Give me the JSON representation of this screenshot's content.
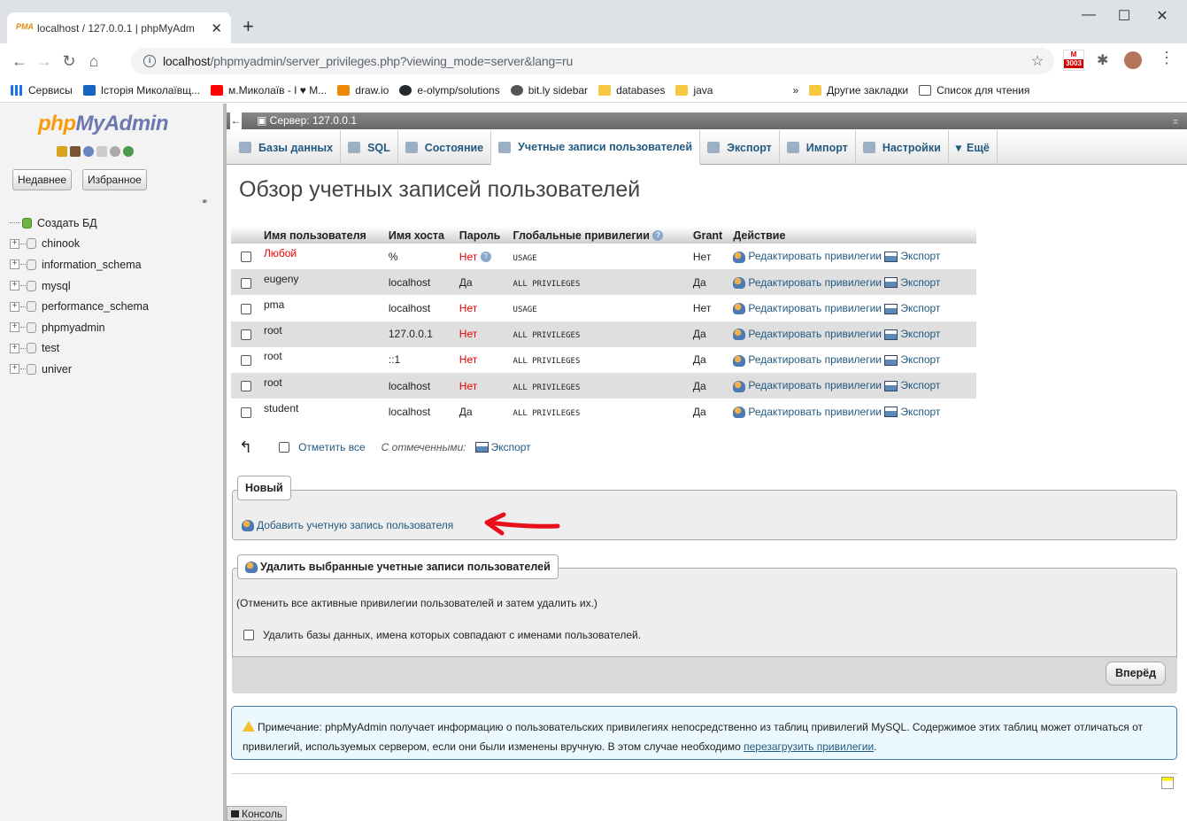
{
  "browser": {
    "tab_title": "localhost / 127.0.0.1 | phpMyAdm",
    "tab_favicon": "PMA",
    "url_host": "localhost",
    "url_path": "/phpmyadmin/server_privileges.php?viewing_mode=server&lang=ru",
    "ext_badge": "3003",
    "ext_label": "M",
    "bookmarks": [
      {
        "label": "Сервисы",
        "icon": "apps-icon"
      },
      {
        "label": "Історія Миколаївщ...",
        "icon": "bookmark-icon"
      },
      {
        "label": "м.Миколаїв - I ♥ M...",
        "icon": "youtube-icon"
      },
      {
        "label": "draw.io",
        "icon": "drawio-icon"
      },
      {
        "label": "e-olymp/solutions",
        "icon": "github-icon"
      },
      {
        "label": "bit.ly sidebar",
        "icon": "bitly-icon"
      },
      {
        "label": "databases",
        "icon": "folder-icon"
      },
      {
        "label": "java",
        "icon": "folder-icon"
      }
    ],
    "bm_more": "»",
    "bm_other": "Другие закладки",
    "bm_reading": "Список для чтения"
  },
  "nav": {
    "logo_php": "php",
    "logo_myadmin": "MyAdmin",
    "recent": "Недавнее",
    "favorites": "Избранное",
    "create_db": "Создать БД",
    "databases": [
      "chinook",
      "information_schema",
      "mysql",
      "performance_schema",
      "phpmyadmin",
      "test",
      "univer"
    ]
  },
  "main": {
    "server_label": "Сервер: 127.0.0.1",
    "tabs": [
      "Базы данных",
      "SQL",
      "Состояние",
      "Учетные записи пользователей",
      "Экспорт",
      "Импорт",
      "Настройки",
      "Ещё"
    ],
    "title": "Обзор учетных записей пользователей",
    "table": {
      "headers": [
        "Имя пользователя",
        "Имя хоста",
        "Пароль",
        "Глобальные привилегии",
        "Grant",
        "Действие"
      ],
      "rows": [
        {
          "user": "Любой",
          "host": "%",
          "password": "Нет",
          "privileges": "USAGE",
          "grant": "Нет"
        },
        {
          "user": "eugeny",
          "host": "localhost",
          "password": "Да",
          "privileges": "ALL PRIVILEGES",
          "grant": "Да"
        },
        {
          "user": "pma",
          "host": "localhost",
          "password": "Нет",
          "privileges": "USAGE",
          "grant": "Нет"
        },
        {
          "user": "root",
          "host": "127.0.0.1",
          "password": "Нет",
          "privileges": "ALL PRIVILEGES",
          "grant": "Да"
        },
        {
          "user": "root",
          "host": "::1",
          "password": "Нет",
          "privileges": "ALL PRIVILEGES",
          "grant": "Да"
        },
        {
          "user": "root",
          "host": "localhost",
          "password": "Нет",
          "privileges": "ALL PRIVILEGES",
          "grant": "Да"
        },
        {
          "user": "student",
          "host": "localhost",
          "password": "Да",
          "privileges": "ALL PRIVILEGES",
          "grant": "Да"
        }
      ],
      "edit_label": "Редактировать привилегии",
      "export_label": "Экспорт"
    },
    "check_all": "Отметить все",
    "with_selected": "С отмеченными:",
    "export": "Экспорт",
    "new_legend": "Новый",
    "add_user": "Добавить учетную запись пользователя",
    "delete_legend": "Удалить выбранные учетные записи пользователей",
    "delete_note": "(Отменить все активные привилегии пользователей и затем удалить их.)",
    "drop_db": "Удалить базы данных, имена которых совпадают с именами пользователей.",
    "go": "Вперёд",
    "notice_text": "Примечание: phpMyAdmin получает информацию о пользовательских привилегиях непосредственно из таблиц привилегий MySQL. Содержимое этих таблиц может отличаться от привилегий, используемых сервером, если они были изменены вручную. В этом случае необходимо",
    "notice_link": "перезагрузить привилегии",
    "notice_end": ".",
    "console": "Консоль"
  },
  "colors": {
    "link": "#235a81",
    "red": "#e00000",
    "annotation_arrow": "#e8101a"
  }
}
